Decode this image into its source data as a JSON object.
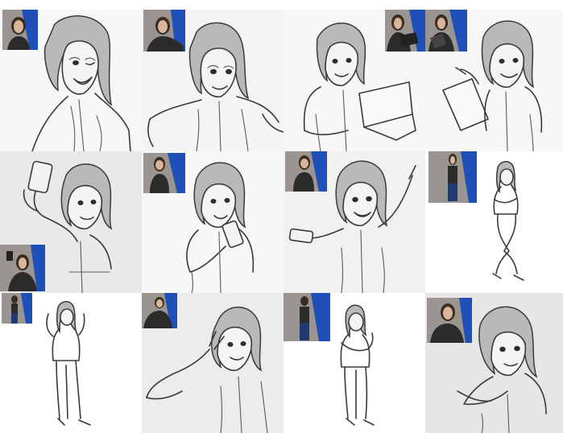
{
  "sheet": {
    "description_free": true,
    "colors": {
      "paper_light": "#f7f7f7",
      "paper_gray": "#ececec",
      "line": "#3a3a3a",
      "hair_tone": "#b9b9b9",
      "photo_backdrop_blue": "#1f4fb8",
      "photo_backdrop_gray": "#9a9590",
      "photo_outfit": "#2b2b2b"
    },
    "panels": [
      {
        "id": "p1",
        "pose": "wink-tongue",
        "paper": "#f7f7f7",
        "icon": "reference-photo",
        "refs": 1
      },
      {
        "id": "p2",
        "pose": "reaching-out",
        "paper": "#f4f4f4",
        "icon": "reference-photo",
        "refs": 1
      },
      {
        "id": "p3",
        "pose": "laptop",
        "paper": "#f7f7f7",
        "icon": "reference-photo",
        "refs": 2
      },
      {
        "id": "p4",
        "pose": "tablet-pointing",
        "paper": "#f7f7f7",
        "icon": "none",
        "refs": 0
      },
      {
        "id": "p5",
        "pose": "selfie",
        "paper": "#e9e9e9",
        "icon": "reference-photo",
        "refs": 1
      },
      {
        "id": "p6",
        "pose": "phone",
        "paper": "#f7f7f7",
        "icon": "reference-photo",
        "refs": 1
      },
      {
        "id": "p7",
        "pose": "pointing-up",
        "paper": "#f1f1f1",
        "icon": "reference-photo",
        "refs": 1
      },
      {
        "id": "p8",
        "pose": "standing-crossed",
        "paper": "#ffffff",
        "icon": "reference-photo",
        "refs": 1
      },
      {
        "id": "p9",
        "pose": "waving-full",
        "paper": "#ffffff",
        "icon": "reference-photo",
        "refs": 1
      },
      {
        "id": "p10",
        "pose": "peace-sign",
        "paper": "#ececec",
        "icon": "reference-photo",
        "refs": 1
      },
      {
        "id": "p11",
        "pose": "standing-arms",
        "paper": "#ffffff",
        "icon": "reference-photo",
        "refs": 1
      },
      {
        "id": "p12",
        "pose": "hand-chest",
        "paper": "#e6e6e6",
        "icon": "reference-photo",
        "refs": 1
      }
    ]
  }
}
